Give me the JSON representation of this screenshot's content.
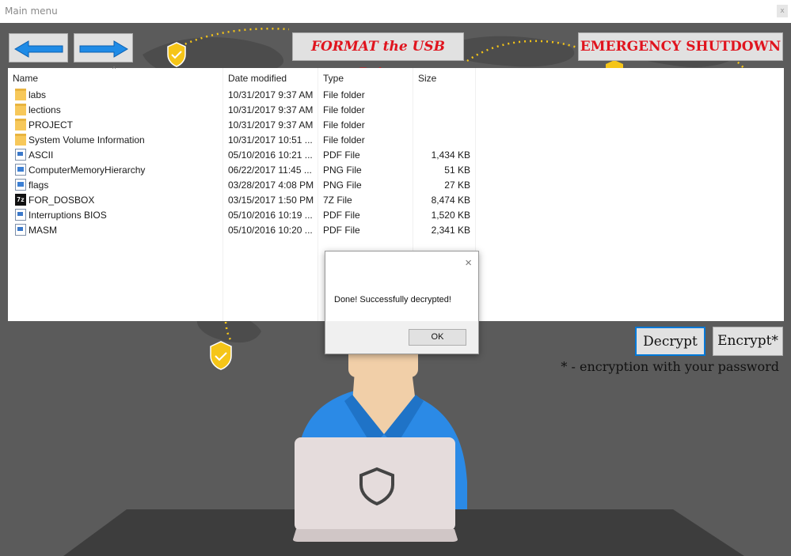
{
  "window": {
    "title": "Main menu",
    "close_glyph": "x"
  },
  "toolbar": {
    "back_icon": "arrow-left-icon",
    "forward_icon": "arrow-right-icon",
    "format_label": "FORMAT the USB Drive",
    "shutdown_label": "EMERGENCY SHUTDOWN"
  },
  "file_list": {
    "columns": {
      "name": "Name",
      "date": "Date modified",
      "type": "Type",
      "size": "Size"
    },
    "sort_indicator": "^",
    "rows": [
      {
        "icon": "folder-icon",
        "name": "labs",
        "date": "10/31/2017 9:37 AM",
        "type": "File folder",
        "size": ""
      },
      {
        "icon": "folder-icon",
        "name": "lections",
        "date": "10/31/2017 9:37 AM",
        "type": "File folder",
        "size": ""
      },
      {
        "icon": "folder-icon",
        "name": "PROJECT",
        "date": "10/31/2017 9:37 AM",
        "type": "File folder",
        "size": ""
      },
      {
        "icon": "folder-icon",
        "name": "System Volume Information",
        "date": "10/31/2017 10:51 ...",
        "type": "File folder",
        "size": ""
      },
      {
        "icon": "pdf-icon",
        "name": "ASCII",
        "date": "05/10/2016 10:21 ...",
        "type": "PDF File",
        "size": "1,434 KB"
      },
      {
        "icon": "png-icon",
        "name": "ComputerMemoryHierarchy",
        "date": "06/22/2017 11:45 ...",
        "type": "PNG File",
        "size": "51 KB"
      },
      {
        "icon": "png-icon",
        "name": "flags",
        "date": "03/28/2017 4:08 PM",
        "type": "PNG File",
        "size": "27 KB"
      },
      {
        "icon": "sevenz-icon",
        "name": "FOR_DOSBOX",
        "date": "03/15/2017 1:50 PM",
        "type": "7Z File",
        "size": "8,474 KB"
      },
      {
        "icon": "pdf-icon",
        "name": "Interruptions BIOS",
        "date": "05/10/2016 10:19 ...",
        "type": "PDF File",
        "size": "1,520 KB"
      },
      {
        "icon": "pdf-icon",
        "name": "MASM",
        "date": "05/10/2016 10:20 ...",
        "type": "PDF File",
        "size": "2,341 KB"
      }
    ]
  },
  "dialog": {
    "message": "Done! Successfully decrypted!",
    "ok_label": "OK",
    "close_glyph": "×"
  },
  "actions": {
    "decrypt_label": "Decrypt",
    "encrypt_label": "Encrypt*",
    "note": "* - encryption with your password"
  },
  "colors": {
    "accent_red": "#e0141e",
    "arrow_blue": "#1f8be6",
    "shield_yellow": "#f5c518",
    "shirt_blue": "#2b8ae6"
  }
}
